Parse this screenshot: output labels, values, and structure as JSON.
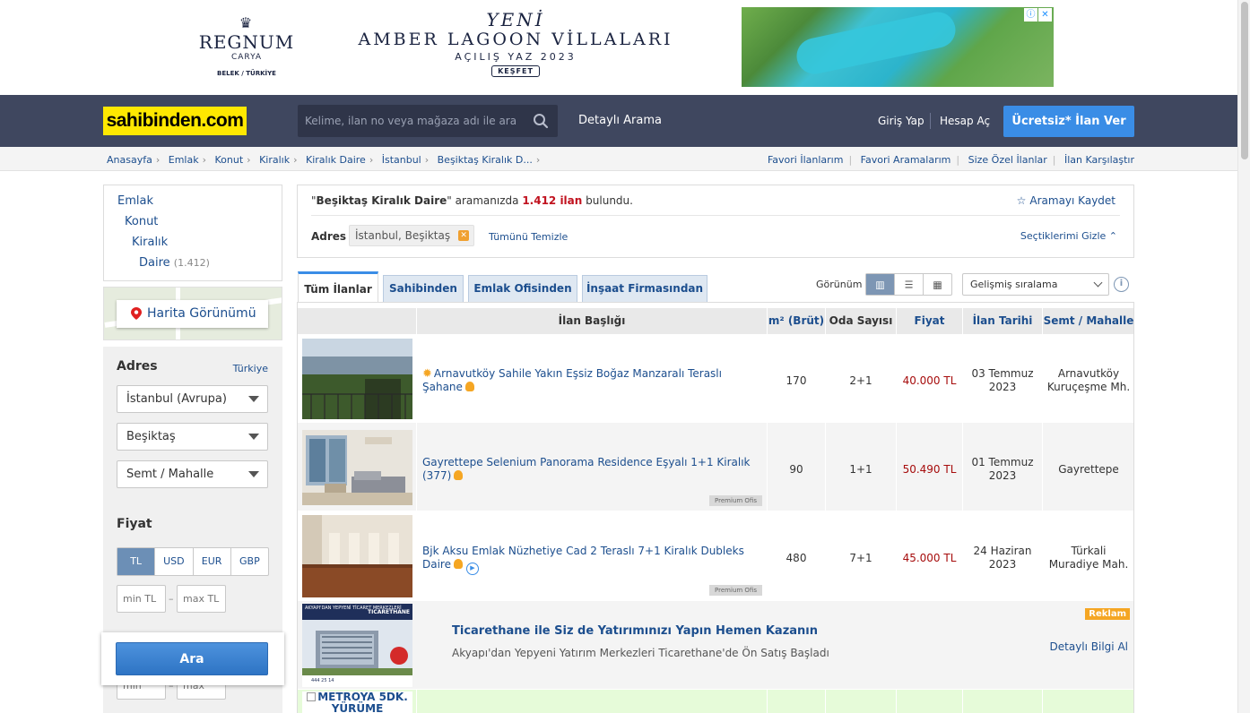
{
  "ad": {
    "brand": "REGNUM",
    "brand_sub": "CARYA",
    "brand_loc": "BELEK / TÜRKİYE",
    "headline_top": "YENİ",
    "headline": "AMBER LAGOON VİLLALARI",
    "subline": "AÇILIŞ YAZ 2023",
    "cta": "KEŞFET"
  },
  "header": {
    "logo": "sahibinden.com",
    "search_placeholder": "Kelime, ilan no veya mağaza adı ile ara",
    "detailed_search": "Detaylı Arama",
    "login": "Giriş Yap",
    "register": "Hesap Aç",
    "post_ad": "Ücretsiz* İlan Ver"
  },
  "breadcrumb": [
    "Anasayfa",
    "Emlak",
    "Konut",
    "Kiralık",
    "Kiralık Daire",
    "İstanbul",
    "Beşiktaş Kiralık D..."
  ],
  "top_links": [
    "Favori İlanlarım",
    "Favori Aramalarım",
    "Size Özel İlanlar",
    "İlan Karşılaştır"
  ],
  "categories": {
    "emlak": "Emlak",
    "konut": "Konut",
    "kiralik": "Kiralık",
    "daire": "Daire",
    "daire_count": "(1.412)"
  },
  "map_button": "Harita Görünümü",
  "filters": {
    "address_title": "Adres",
    "country_link": "Türkiye",
    "city": "İstanbul (Avrupa)",
    "district": "Beşiktaş",
    "neighborhood": "Semt / Mahalle",
    "price_title": "Fiyat",
    "currencies": [
      "TL",
      "USD",
      "EUR",
      "GBP"
    ],
    "min_placeholder": "min TL",
    "max_placeholder": "max TL",
    "min2_placeholder": "min",
    "max2_placeholder": "max",
    "search_button": "Ara"
  },
  "results": {
    "query_open": "\"",
    "query": "Beşiktaş Kiralık Daire",
    "query_close": "\" aramanızda",
    "count": "1.412 ilan",
    "suffix": "bulundu.",
    "save_search": "Aramayı Kaydet",
    "address_label": "Adres",
    "address_chip": "İstanbul, Beşiktaş",
    "clear_all": "Tümünü Temizle",
    "hide_selections": "Seçtiklerimi Gizle"
  },
  "tabs": [
    "Tüm İlanlar",
    "Sahibinden",
    "Emlak Ofisinden",
    "İnşaat Firmasından"
  ],
  "view": {
    "label": "Görünüm",
    "sort": "Gelişmiş sıralama"
  },
  "table": {
    "headers": [
      "İlan Başlığı",
      "m² (Brüt)",
      "Oda Sayısı",
      "Fiyat",
      "İlan Tarihi",
      "Semt / Mahalle"
    ],
    "rows": [
      {
        "title": "Arnavutköy Sahile Yakın Eşsiz Boğaz Manzaralı Teraslı Şahane",
        "m2": "170",
        "rooms": "2+1",
        "price": "40.000 TL",
        "date_day": "03 Temmuz",
        "date_year": "2023",
        "loc1": "Arnavutköy",
        "loc2": "Kuruçeşme Mh."
      },
      {
        "title": "Gayrettepe Selenium Panorama Residence Eşyalı 1+1 Kiralık (377)",
        "m2": "90",
        "rooms": "1+1",
        "price": "50.490 TL",
        "date_day": "01 Temmuz",
        "date_year": "2023",
        "loc1": "Gayrettepe",
        "loc2": "",
        "premium": "Premium Ofis"
      },
      {
        "title": "Bjk Aksu Emlak Nüzhetiye Cad 2 Teraslı 7+1 Kiralık Dubleks Daire",
        "m2": "480",
        "rooms": "7+1",
        "price": "45.000 TL",
        "date_day": "24 Haziran",
        "date_year": "2023",
        "loc1": "Türkali",
        "loc2": "Muradiye Mah.",
        "premium": "Premium Ofis"
      }
    ],
    "ad_row": {
      "title": "Ticarethane ile Siz de Yatırımınızı Yapın Hemen Kazanın",
      "desc": "Akyapı'dan Yepyeni Yatırım Merkezleri Ticarethane'de Ön Satış Başladı",
      "badge": "Reklam",
      "more": "Detaylı Bilgi Al",
      "thumb_title": "TICARETHANE",
      "thumb_sub": "AKYAPI'DAN YEPYENİ TİCARET MERKEZLERİ",
      "thumb_phone": "444 25 14"
    },
    "partial_row_thumb": "METROYA 5DK. YÜRÜME"
  }
}
